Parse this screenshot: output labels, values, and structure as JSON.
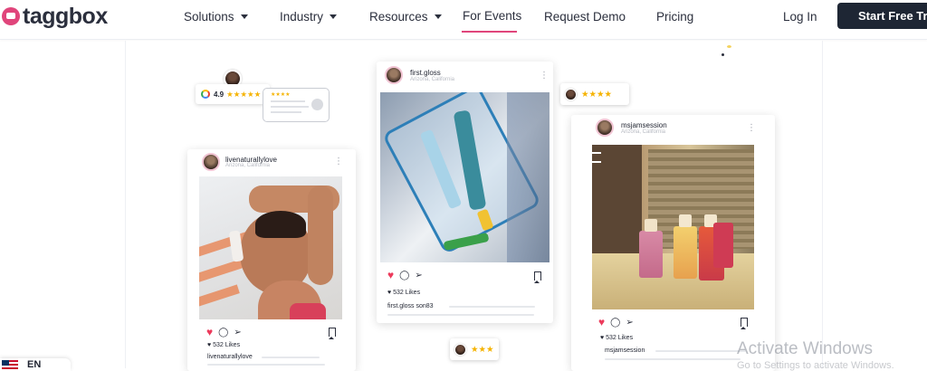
{
  "brand": {
    "name": "taggbox",
    "accent": "#e0457b"
  },
  "nav": {
    "items": [
      {
        "label": "Solutions",
        "dropdown": true
      },
      {
        "label": "Industry",
        "dropdown": true
      },
      {
        "label": "Resources",
        "dropdown": true
      },
      {
        "label": "For Events",
        "dropdown": false,
        "active": true
      },
      {
        "label": "Request Demo",
        "dropdown": false
      },
      {
        "label": "Pricing",
        "dropdown": false
      }
    ],
    "login_label": "Log In",
    "cta_label": "Start Free Trial"
  },
  "review_badge": {
    "rating": "4.9",
    "stars": "★★★★★",
    "source_icon": "google-icon"
  },
  "bubble": {
    "stars": "★★★★"
  },
  "chips": [
    {
      "stars": "★★★★"
    },
    {
      "stars": "★★★"
    }
  ],
  "posts": [
    {
      "username": "livenaturallylove",
      "location": "Arizona, California",
      "likes": "532 Likes",
      "caption_user": "livenaturallylove"
    },
    {
      "username": "first.gloss",
      "location": "Arizona, California",
      "likes": "532 Likes",
      "caption_user": "first.gloss son83"
    },
    {
      "username": "msjamsession",
      "location": "Arizona, California",
      "likes": "532 Likes",
      "caption_user": "msjamsession"
    }
  ],
  "overlay": {
    "activate_title": "Activate Windows",
    "activate_sub": "Go to Settings to activate Windows.",
    "language": "EN"
  }
}
